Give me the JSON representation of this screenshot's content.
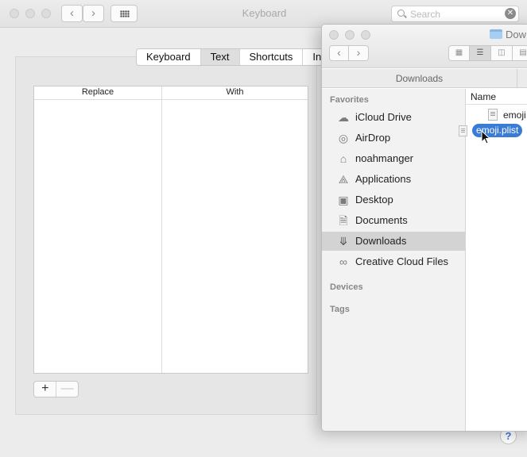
{
  "keyboard_window": {
    "title": "Keyboard",
    "search_placeholder": "Search",
    "tabs": [
      {
        "label": "Keyboard",
        "active": false
      },
      {
        "label": "Text",
        "active": true
      },
      {
        "label": "Shortcuts",
        "active": false
      },
      {
        "label": "In",
        "active": false
      }
    ],
    "table": {
      "columns": [
        "Replace",
        "With"
      ],
      "rows": []
    },
    "add_label": "+",
    "remove_label": "—",
    "help_label": "?"
  },
  "finder_window": {
    "title": "Dow",
    "path_label": "Downloads",
    "sidebar": {
      "favorites_label": "Favorites",
      "items": [
        {
          "label": "iCloud Drive",
          "icon": "cloud-icon"
        },
        {
          "label": "AirDrop",
          "icon": "airdrop-icon"
        },
        {
          "label": "noahmanger",
          "icon": "home-icon"
        },
        {
          "label": "Applications",
          "icon": "applications-icon"
        },
        {
          "label": "Desktop",
          "icon": "desktop-icon"
        },
        {
          "label": "Documents",
          "icon": "documents-icon"
        },
        {
          "label": "Downloads",
          "icon": "downloads-icon",
          "selected": true
        },
        {
          "label": "Creative Cloud Files",
          "icon": "creative-cloud-icon"
        }
      ],
      "devices_label": "Devices",
      "tags_label": "Tags"
    },
    "list": {
      "column_name": "Name",
      "files": [
        {
          "name": "emoji"
        }
      ]
    }
  },
  "drag": {
    "file_name": "emoji.plist"
  },
  "colors": {
    "selection_blue": "#3a7bd5",
    "sidebar_selected": "#d3d3d3"
  }
}
